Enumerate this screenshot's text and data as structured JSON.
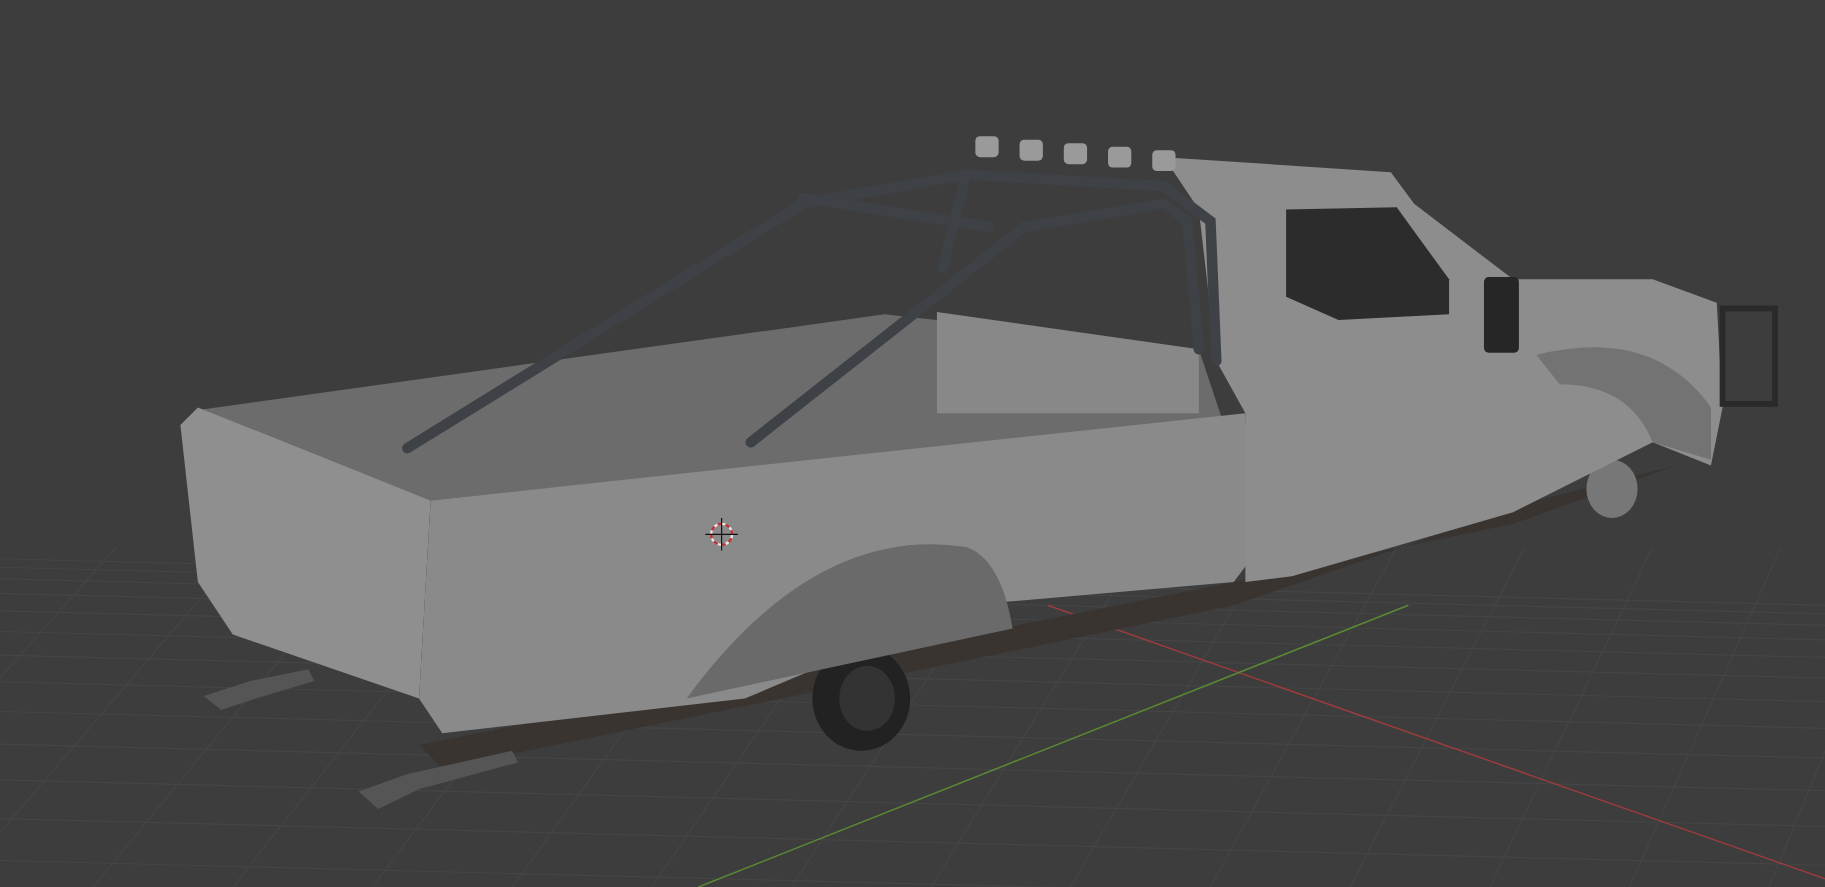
{
  "viewport": {
    "axes": [
      {
        "kind": "x",
        "color": "#9a3c3c"
      },
      {
        "kind": "y",
        "color": "#5a8a34"
      }
    ]
  }
}
